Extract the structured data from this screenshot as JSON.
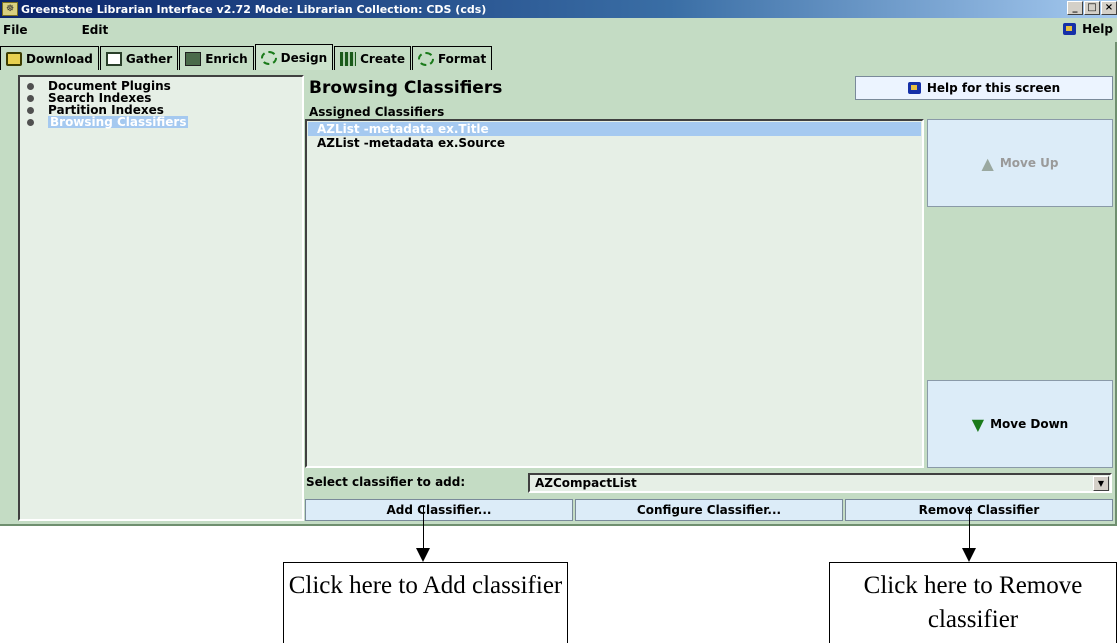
{
  "window": {
    "title": "Greenstone Librarian Interface v2.72  Mode: Librarian  Collection: CDS (cds)",
    "controls": [
      "_",
      "□",
      "×"
    ]
  },
  "menu": {
    "file": "File",
    "edit": "Edit",
    "help": "Help"
  },
  "tabs": [
    {
      "label": "Download",
      "icon": "download-icon"
    },
    {
      "label": "Gather",
      "icon": "gather-icon"
    },
    {
      "label": "Enrich",
      "icon": "enrich-icon"
    },
    {
      "label": "Design",
      "icon": "design-icon",
      "active": true
    },
    {
      "label": "Create",
      "icon": "create-icon"
    },
    {
      "label": "Format",
      "icon": "format-icon"
    }
  ],
  "tree": {
    "items": [
      "Document Plugins",
      "Search Indexes",
      "Partition Indexes",
      "Browsing Classifiers"
    ],
    "selected": "Browsing Classifiers"
  },
  "main": {
    "heading": "Browsing Classifiers",
    "help_button": "Help for this screen",
    "assigned_label": "Assigned Classifiers",
    "classifiers": [
      {
        "label": "AZList -metadata ex.Title",
        "selected": true
      },
      {
        "label": "AZList -metadata ex.Source",
        "selected": false
      }
    ],
    "move_up": "Move Up",
    "move_down": "Move Down",
    "select_label": "Select classifier to add:",
    "select_value": "AZCompactList",
    "buttons": {
      "add": "Add Classifier...",
      "configure": "Configure Classifier...",
      "remove": "Remove Classifier"
    }
  },
  "annotations": {
    "add": "Click here to Add classifier",
    "remove": "Click here to Remove classifier"
  },
  "colors": {
    "app_bg": "#c4dcc4",
    "panel_bg": "#e6efe6",
    "selection": "#a5c9f0",
    "button_bg": "#dcecf8",
    "titlebar": "#0a246a"
  }
}
